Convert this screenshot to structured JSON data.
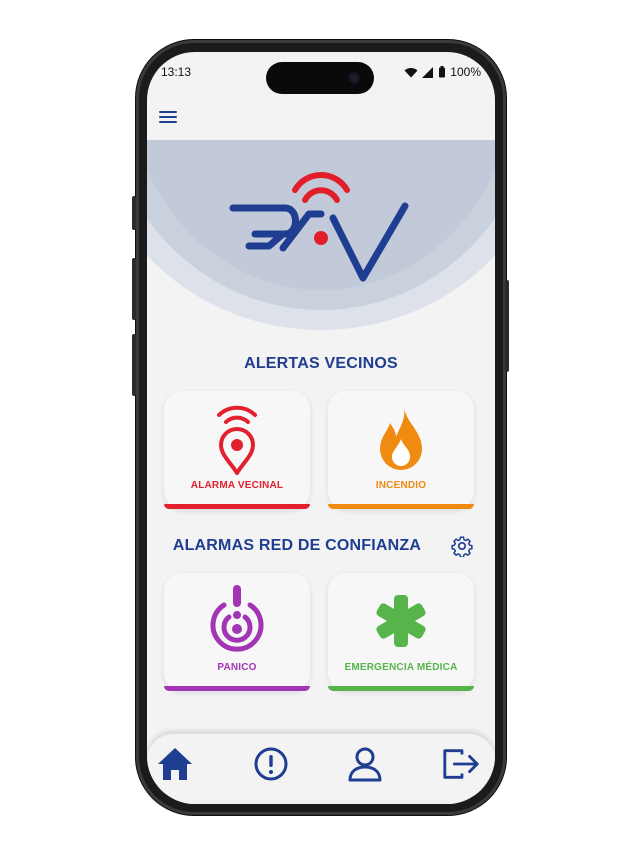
{
  "status_bar": {
    "time": "13:13",
    "battery": "100%"
  },
  "header": {
    "menu_icon": "hamburger-menu-icon"
  },
  "brand": {
    "logo": "RAV",
    "colors": {
      "blue": "#1f3d91",
      "red": "#e31e2b"
    }
  },
  "sections": {
    "alerts_title": "ALERTAS VECINOS",
    "trust_title": "ALARMAS RED DE CONFIANZA"
  },
  "cards": {
    "alarm": {
      "label": "ALARMA VECINAL",
      "icon": "location-signal-icon",
      "color": "#e2202e"
    },
    "fire": {
      "label": "INCENDIO",
      "icon": "flame-icon",
      "color": "#f08a10"
    },
    "panic": {
      "label": "PANICO",
      "icon": "panic-target-icon",
      "color": "#a135b4"
    },
    "medical": {
      "label": "EMERGENCIA MÉDICA",
      "icon": "medical-asterisk-icon",
      "color": "#56b44b"
    }
  },
  "tabbar": {
    "items": [
      {
        "name": "home",
        "icon": "home-icon"
      },
      {
        "name": "alerts",
        "icon": "alert-circle-icon"
      },
      {
        "name": "profile",
        "icon": "user-icon"
      },
      {
        "name": "logout",
        "icon": "logout-icon"
      }
    ]
  }
}
